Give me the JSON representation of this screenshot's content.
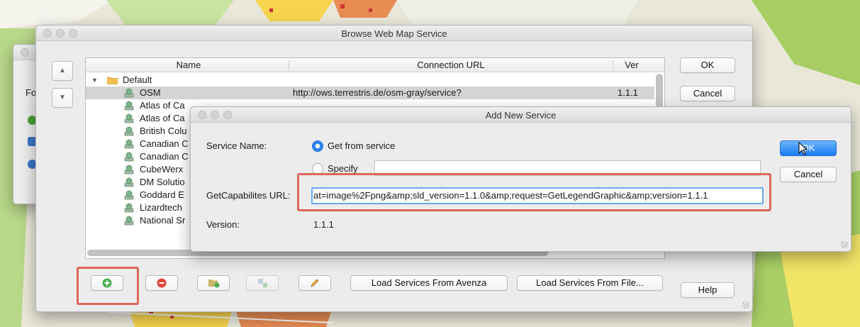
{
  "browse_window": {
    "title": "Browse Web Map Service",
    "columns": [
      "Name",
      "Connection URL",
      "Ver"
    ],
    "group": "Default",
    "rows": [
      {
        "name": "OSM",
        "url": "http://ows.terrestris.de/osm-gray/service?",
        "ver": "1.1.1"
      },
      {
        "name": "Atlas of Ca",
        "url": "",
        "ver": ""
      },
      {
        "name": "Atlas of Ca",
        "url": "",
        "ver": ""
      },
      {
        "name": "British Colu",
        "url": "",
        "ver": ""
      },
      {
        "name": "Canadian C",
        "url": "",
        "ver": ""
      },
      {
        "name": "Canadian C",
        "url": "",
        "ver": ""
      },
      {
        "name": "CubeWerx",
        "url": "",
        "ver": ""
      },
      {
        "name": "DM Solutio",
        "url": "",
        "ver": ""
      },
      {
        "name": "Goddard E",
        "url": "",
        "ver": ""
      },
      {
        "name": "Lizardtech",
        "url": "",
        "ver": ""
      },
      {
        "name": "National Sr",
        "url": "",
        "ver": ""
      }
    ],
    "ok_label": "OK",
    "cancel_label": "Cancel",
    "help_label": "Help",
    "load_avenza_label": "Load Services From Avenza",
    "load_file_label": "Load Services From File...",
    "up_arrow": "▲",
    "down_arrow": "▼"
  },
  "side_window": {
    "label": "Fo"
  },
  "add_dialog": {
    "title": "Add New Service",
    "service_name_label": "Service Name:",
    "option_get_from_service": "Get from service",
    "option_specify": "Specify",
    "specify_value": "",
    "getcap_label": "GetCapabilites URL:",
    "getcap_value": "at=image%2Fpng&amp;sld_version=1.1.0&amp;request=GetLegendGraphic&amp;version=1.1.1",
    "version_label": "Version:",
    "version_value": "1.1.1",
    "ok_label": "OK",
    "cancel_label": "Cancel"
  },
  "icons": [
    "folder-icon",
    "service-icon",
    "add-icon",
    "remove-icon",
    "add-folder-icon",
    "move-icon",
    "edit-icon"
  ],
  "colors": {
    "highlight": "#e0665a",
    "accent": "#1a7cf5"
  }
}
